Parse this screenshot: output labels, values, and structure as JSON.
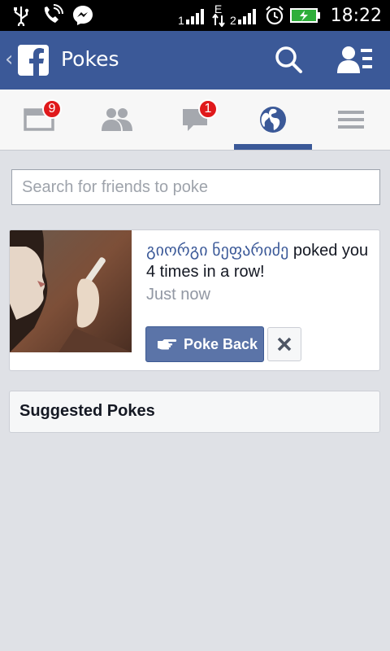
{
  "status_bar": {
    "time": "18:22",
    "network_type": "E",
    "sim2_label": "2",
    "icons": [
      "usb-icon",
      "missed-call-icon",
      "messenger-icon",
      "signal-icon",
      "data-arrows-icon",
      "alarm-icon",
      "battery-charging-icon"
    ]
  },
  "header": {
    "title": "Pokes",
    "brand_color": "#3b5998",
    "icons": [
      "back-chevron-icon",
      "facebook-logo-icon",
      "search-icon",
      "friend-requests-icon"
    ]
  },
  "nav": {
    "tabs": [
      {
        "name": "news-feed",
        "icon": "news-feed-icon",
        "badge": "9"
      },
      {
        "name": "friends",
        "icon": "friends-icon",
        "badge": ""
      },
      {
        "name": "messages",
        "icon": "chat-bubble-icon",
        "badge": "1"
      },
      {
        "name": "notifications",
        "icon": "globe-icon",
        "badge": "",
        "active": true
      },
      {
        "name": "more",
        "icon": "menu-icon",
        "badge": ""
      }
    ],
    "badge_color": "#e0191b"
  },
  "search": {
    "placeholder": "Search for friends to poke",
    "value": ""
  },
  "poke_card": {
    "name": "გიორგი ნეფარიძე",
    "message": " poked you 4 times in a row!",
    "time": "Just now",
    "poke_back_label": "Poke Back",
    "dismiss_label": "✕"
  },
  "suggested": {
    "label": "Suggested Pokes"
  }
}
